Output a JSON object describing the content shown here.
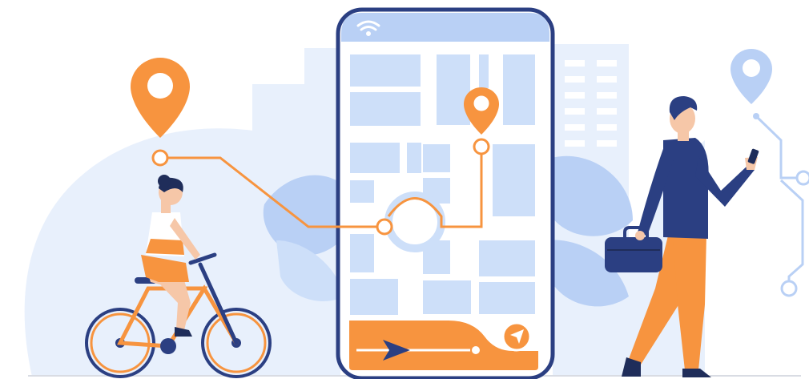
{
  "colors": {
    "background": "#ffffff",
    "pale_blue": "#e8f0fc",
    "light_blue": "#cddff9",
    "mid_blue": "#b9d0f5",
    "accent_orange": "#f7943f",
    "navy": "#2b3f82",
    "dark_navy": "#1f2d5a",
    "skin": "#f6c7a8",
    "ground_line": "#d9dce3"
  },
  "icons": {
    "wifi": "wifi-icon",
    "navigate": "navigation-arrow-icon",
    "location_pins": "map-pin-icon",
    "play_marker": "play-arrow-icon"
  }
}
